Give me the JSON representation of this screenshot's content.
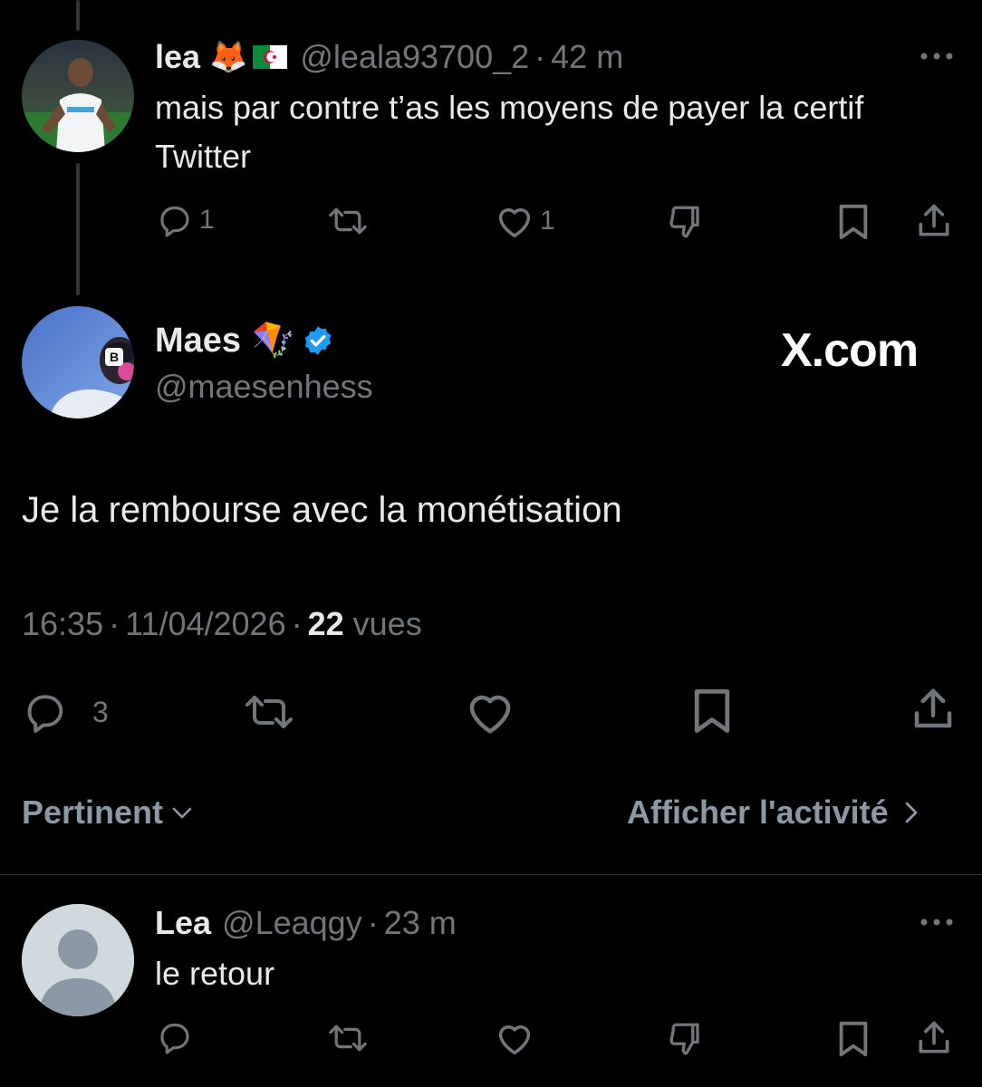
{
  "reply_top": {
    "name": "lea",
    "emoji_fox": "🦊",
    "handle": "@leala93700_2",
    "separator": "·",
    "time": "42 m",
    "text": "mais par contre t’as les moyens de payer la certif Twitter",
    "reply_count": "1",
    "like_count": "1"
  },
  "main_tweet": {
    "name": "Maes",
    "kite_emoji": "🪁",
    "handle": "@maesenhess",
    "watermark": "X.com",
    "text": "Je la rembourse avec la monétisation",
    "time": "16:35",
    "sep1": "·",
    "date": "11/04/2026",
    "sep2": "·",
    "views_count": "22",
    "views_label": "vues",
    "reply_count": "3"
  },
  "sort_bar": {
    "sort_label": "Pertinent",
    "activity_label": "Afficher l'activité"
  },
  "reply_bottom": {
    "name": "Lea",
    "handle": "@Leaqgy",
    "separator": "·",
    "time": "23 m",
    "text": "le retour"
  },
  "colors": {
    "background": "#000000",
    "text": "#e7e9ea",
    "muted": "#71767b",
    "verified": "#1d9bf0",
    "divider": "#2f3336"
  },
  "icons": [
    "reply-icon",
    "retweet-icon",
    "like-icon",
    "dislike-icon",
    "bookmark-icon",
    "share-icon",
    "more-icon",
    "verified-badge-icon",
    "chevron-down-icon",
    "chevron-right-icon",
    "algeria-flag-icon"
  ]
}
